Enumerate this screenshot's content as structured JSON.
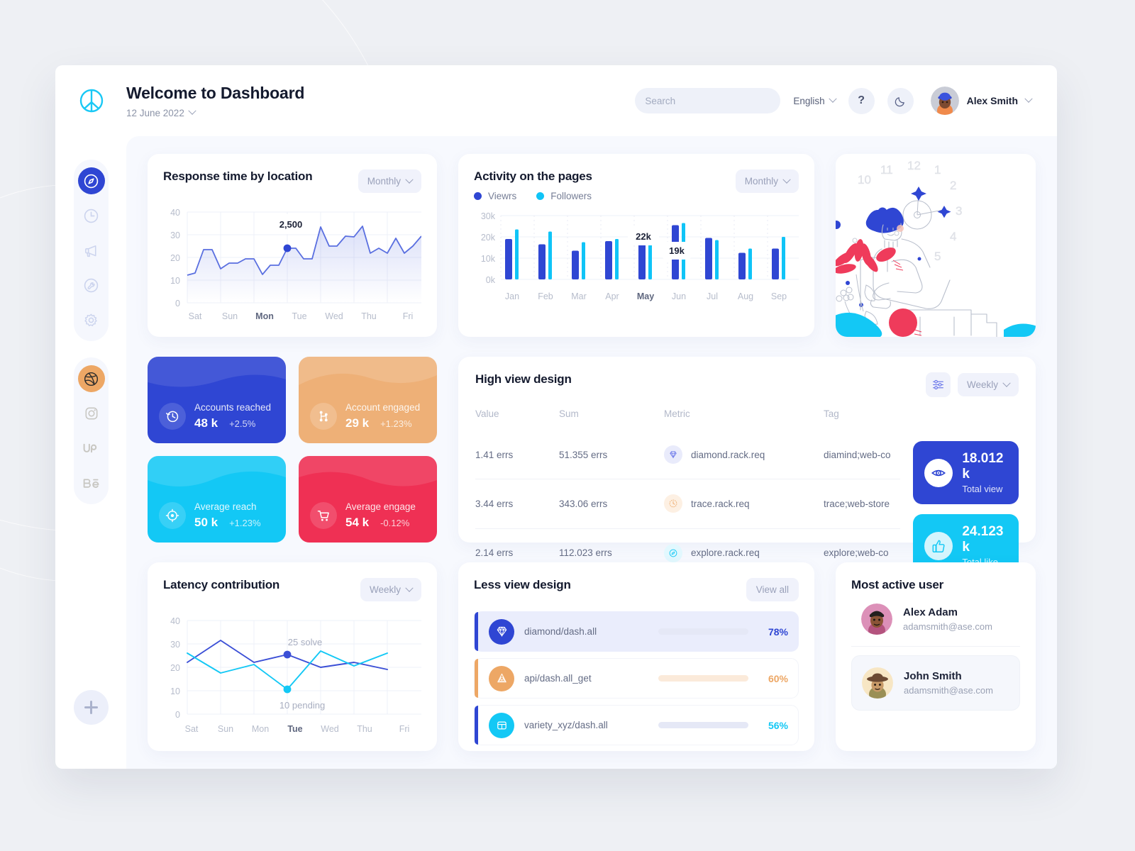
{
  "brand": {
    "logo_icon": "peace-circle-logo"
  },
  "header": {
    "title": "Welcome to Dashboard",
    "date": "12 June 2022",
    "search": {
      "placeholder": "Search",
      "value": "",
      "icon": "search-icon"
    },
    "language": "English",
    "help_label": "?",
    "dark_mode_icon": "moon-icon",
    "user": "Alex Smith"
  },
  "sidebar": {
    "nav": [
      {
        "name": "compass",
        "label": "Explore",
        "active": true
      },
      {
        "name": "clock",
        "label": "History",
        "active": false
      },
      {
        "name": "megaphone",
        "label": "Announcements",
        "active": false
      },
      {
        "name": "tools",
        "label": "Tools",
        "active": false
      },
      {
        "name": "gear",
        "label": "Settings",
        "active": false
      }
    ],
    "social": [
      {
        "name": "dribbble",
        "label": "Dribbble",
        "active": true
      },
      {
        "name": "instagram",
        "label": "Instagram",
        "active": false
      },
      {
        "name": "upwork",
        "label": "Upwork",
        "active": false
      },
      {
        "name": "behance",
        "label": "Behance",
        "active": false
      }
    ],
    "add_label": "+"
  },
  "response_card": {
    "title": "Response time by location",
    "filter": "Monthly",
    "tooltip": "2,500"
  },
  "activity_card": {
    "title": "Activity on the pages",
    "filter": "Monthly",
    "legend": [
      {
        "label": "Viewrs",
        "color": "#2f46d3"
      },
      {
        "label": "Followers",
        "color": "#0fc4f7"
      }
    ],
    "tooltips": [
      "22k",
      "19k"
    ]
  },
  "tiles": [
    {
      "label": "Accounts reached",
      "value": "48 k",
      "delta": "+2.5%",
      "color": "#2f46d3",
      "icon": "clock-history-icon"
    },
    {
      "label": "Account engaged",
      "value": "29 k",
      "delta": "+1.23%",
      "color": "#eeb077",
      "icon": "share-nodes-icon"
    },
    {
      "label": "Average reach",
      "value": "50 k",
      "delta": "+1.23%",
      "color": "#13c8f5",
      "icon": "target-icon"
    },
    {
      "label": "Average engage",
      "value": "54 k",
      "delta": "-0.12%",
      "color": "#ef3054",
      "icon": "cart-icon"
    }
  ],
  "high_view": {
    "title": "High view design",
    "filter": "Weekly",
    "settings_icon": "sliders-icon",
    "columns": [
      "Value",
      "Sum",
      "Metric",
      "Tag"
    ],
    "rows": [
      {
        "value": "1.41 errs",
        "sum": "51.355 errs",
        "metric": "diamond.rack.req",
        "tag": "diamind;web-co",
        "icon": "diamond-icon",
        "icon_color": "#6f7bea",
        "icon_bg": "#e9ebfb"
      },
      {
        "value": "3.44 errs",
        "sum": "343.06 errs",
        "metric": "trace.rack.req",
        "tag": "trace;web-store",
        "icon": "clock-icon",
        "icon_color": "#eda765",
        "icon_bg": "#fdf0e3"
      },
      {
        "value": "2.14 errs",
        "sum": "112.023 errs",
        "metric": "explore.rack.req",
        "tag": "explore;web-co",
        "icon": "compass-icon",
        "icon_color": "#13c8f5",
        "icon_bg": "#e2f8fe"
      }
    ],
    "totals": [
      {
        "number": "18.012 k",
        "label": "Total view",
        "color": "#2f46d3",
        "icon": "eye-icon"
      },
      {
        "number": "24.123 k",
        "label": "Total like",
        "color": "#13c8f5",
        "icon": "thumbs-up-icon"
      }
    ]
  },
  "latency_card": {
    "title": "Latency contribution",
    "filter": "Weekly",
    "annotations": [
      "25 solve",
      "10 pending"
    ]
  },
  "less_view": {
    "title": "Less view design",
    "view_all": "View all",
    "rows": [
      {
        "name": "diamond/dash.all",
        "pct": "78%",
        "value": 78,
        "color": "#2f46d3",
        "icon": "diamond-icon",
        "selected": true
      },
      {
        "name": "api/dash.all_get",
        "pct": "60%",
        "value": 60,
        "color": "#eda765",
        "icon": "stack-icon",
        "selected": false
      },
      {
        "name": "variety_xyz/dash.all",
        "pct": "56%",
        "value": 56,
        "color": "#13c8f5",
        "icon": "box-icon",
        "selected": false
      }
    ]
  },
  "active_users": {
    "title": "Most active user",
    "users": [
      {
        "name": "Alex Adam",
        "email": "adamsmith@ase.com",
        "avatar": "avatar-alex"
      },
      {
        "name": "John Smith",
        "email": "adamsmith@ase.com",
        "avatar": "avatar-john"
      }
    ]
  },
  "illustration": {
    "name": "woman-with-clock-illustration",
    "clock_numbers": [
      "10",
      "11",
      "12",
      "1",
      "2",
      "3",
      "4",
      "5"
    ]
  },
  "chart_data": [
    {
      "type": "line",
      "title": "Response time by location",
      "xlabel": "",
      "ylabel": "",
      "ylim": [
        0,
        40
      ],
      "yticks": [
        0,
        10,
        20,
        30,
        40
      ],
      "categories": [
        "Sat",
        "Sun",
        "Mon",
        "Tue",
        "Wed",
        "Thu",
        "Fri"
      ],
      "highlight_category": "Mon",
      "grid": true,
      "point_label": "2,500",
      "values": [
        12,
        13,
        23.3,
        23.3,
        15,
        17.5,
        17.5,
        19.5,
        19.3,
        12.5,
        16.5,
        16.5,
        24,
        24,
        19.5,
        19.3,
        33.5,
        25.2,
        25.2,
        29.5,
        29.2,
        33.8,
        21.8,
        24.2,
        21.8,
        28.5,
        21.8,
        25,
        29.2
      ],
      "marker_index": 13
    },
    {
      "type": "bar",
      "title": "Activity on the pages",
      "xlabel": "",
      "ylabel": "",
      "ylim": [
        0,
        30000
      ],
      "yticks": [
        "0k",
        "10k",
        "20k",
        "30k"
      ],
      "categories": [
        "Jan",
        "Feb",
        "Mar",
        "Apr",
        "May",
        "Jun",
        "Jul",
        "Aug",
        "Sep"
      ],
      "highlight_category": "May",
      "grid": true,
      "series": [
        {
          "name": "Viewrs",
          "color": "#2f46d3",
          "values": [
            19000,
            16500,
            13500,
            18000,
            22000,
            25500,
            19500,
            12500,
            14500
          ]
        },
        {
          "name": "Followers",
          "color": "#0fc4f7",
          "values": [
            23500,
            22500,
            17500,
            19000,
            17500,
            26500,
            18500,
            14500,
            20000
          ]
        }
      ],
      "annotations": [
        {
          "text": "22k",
          "series": "Viewrs",
          "category": "May"
        },
        {
          "text": "19k",
          "series": "Followers",
          "category": "Jun"
        }
      ]
    },
    {
      "type": "line",
      "title": "Latency contribution",
      "xlabel": "",
      "ylabel": "",
      "ylim": [
        0,
        40
      ],
      "yticks": [
        0,
        10,
        20,
        30,
        40
      ],
      "categories": [
        "Sat",
        "Sun",
        "Mon",
        "Tue",
        "Wed",
        "Thu",
        "Fri"
      ],
      "highlight_category": "Tue",
      "grid": true,
      "series": [
        {
          "name": "solve",
          "color": "#3b4fd6",
          "values": [
            22,
            31.5,
            22,
            25.5,
            20,
            22,
            19
          ],
          "marker_index": 3,
          "marker_label": "25 solve"
        },
        {
          "name": "pending",
          "color": "#13c8f5",
          "values": [
            26,
            17.5,
            21,
            10.7,
            27,
            20.5,
            26
          ],
          "marker_index": 3,
          "marker_label": "10 pending"
        }
      ]
    },
    {
      "type": "bar",
      "title": "Less view design",
      "categories": [
        "diamond/dash.all",
        "api/dash.all_get",
        "variety_xyz/dash.all"
      ],
      "values": [
        78,
        60,
        56
      ],
      "unit": "%"
    }
  ]
}
